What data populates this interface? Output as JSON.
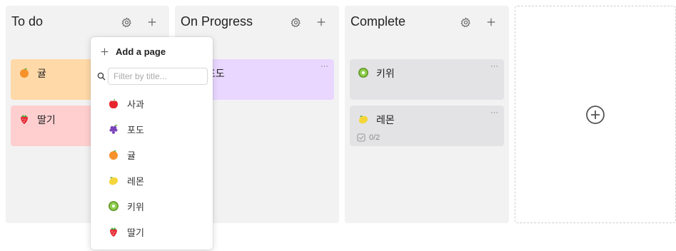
{
  "columns": [
    {
      "title": "To do"
    },
    {
      "title": "On Progress"
    },
    {
      "title": "Complete"
    }
  ],
  "cards": {
    "todo": [
      {
        "label": "귤",
        "icon": "orange-icon",
        "color": "#ffd9a8"
      },
      {
        "label": "딸기",
        "icon": "strawberry-icon",
        "color": "#ffcfd0"
      }
    ],
    "progress": [
      {
        "label": "포도",
        "icon": "grape-icon",
        "color": "#e9d7ff"
      }
    ],
    "complete": [
      {
        "label": "키위",
        "icon": "kiwi-icon",
        "color": "#e3e3e5"
      },
      {
        "label": "레몬",
        "icon": "lemon-icon",
        "color": "#e3e3e5",
        "checklist": "0/2"
      }
    ]
  },
  "card_menu": "···",
  "popup": {
    "add_label": "Add a page",
    "search_placeholder": "Filter by title...",
    "items": [
      {
        "label": "사과",
        "icon": "apple-icon"
      },
      {
        "label": "포도",
        "icon": "grape-icon"
      },
      {
        "label": "귤",
        "icon": "orange-icon"
      },
      {
        "label": "레몬",
        "icon": "lemon-icon"
      },
      {
        "label": "키위",
        "icon": "kiwi-icon"
      },
      {
        "label": "딸기",
        "icon": "strawberry-icon"
      }
    ]
  }
}
